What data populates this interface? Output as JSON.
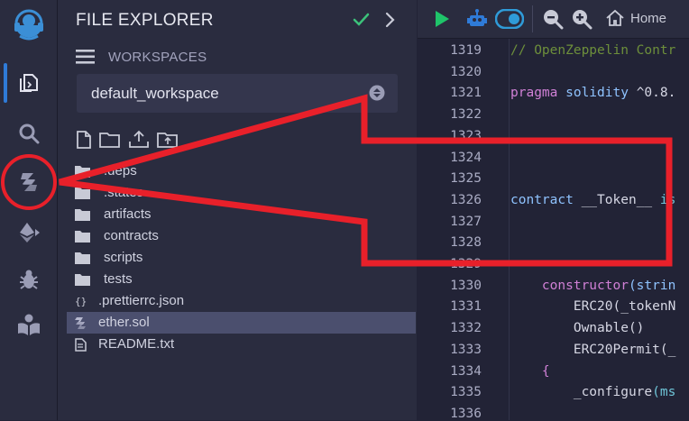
{
  "rail": {
    "items": [
      {
        "name": "logo-icon"
      },
      {
        "name": "file-explorer-icon"
      },
      {
        "name": "search-icon"
      },
      {
        "name": "solidity-compiler-icon"
      },
      {
        "name": "deploy-run-icon"
      },
      {
        "name": "debugger-icon"
      },
      {
        "name": "learneth-icon"
      }
    ]
  },
  "explorer": {
    "title": "FILE EXPLORER",
    "workspaces_label": "WORKSPACES",
    "workspace_value": "default_workspace",
    "actions": [
      "new-file-icon",
      "new-folder-icon",
      "upload-file-icon",
      "upload-folder-icon"
    ],
    "tree": [
      {
        "label": ".deps",
        "type": "folder"
      },
      {
        "label": ".states",
        "type": "folder"
      },
      {
        "label": "artifacts",
        "type": "folder"
      },
      {
        "label": "contracts",
        "type": "folder"
      },
      {
        "label": "scripts",
        "type": "folder"
      },
      {
        "label": "tests",
        "type": "folder"
      },
      {
        "label": ".prettierrc.json",
        "type": "json"
      },
      {
        "label": "ether.sol",
        "type": "sol",
        "selected": true
      },
      {
        "label": "README.txt",
        "type": "txt"
      }
    ]
  },
  "toolbar": {
    "home_label": "Home"
  },
  "editor": {
    "lines": [
      {
        "n": "1319",
        "code": [
          {
            "t": "// OpenZeppelin Contr",
            "c": "c-comment"
          }
        ]
      },
      {
        "n": "1320",
        "code": []
      },
      {
        "n": "1321",
        "code": [
          {
            "t": "pragma ",
            "c": "c-kw"
          },
          {
            "t": "solidity ",
            "c": "c-blue"
          },
          {
            "t": "^0.8.",
            "c": "c-plain"
          }
        ]
      },
      {
        "n": "1322",
        "code": []
      },
      {
        "n": "1323",
        "code": []
      },
      {
        "n": "1324",
        "code": []
      },
      {
        "n": "1325",
        "code": []
      },
      {
        "n": "1326",
        "code": [
          {
            "t": "contract ",
            "c": "c-blue"
          },
          {
            "t": "__Token__ ",
            "c": "c-ident"
          },
          {
            "t": "is",
            "c": "c-cyan"
          }
        ]
      },
      {
        "n": "1327",
        "code": []
      },
      {
        "n": "1328",
        "code": []
      },
      {
        "n": "1329",
        "code": []
      },
      {
        "n": "1330",
        "code": [
          {
            "t": "    constructor",
            "c": "c-kw"
          },
          {
            "t": "(strin",
            "c": "c-blue"
          }
        ]
      },
      {
        "n": "1331",
        "code": [
          {
            "t": "        ERC20",
            "c": "c-plain"
          },
          {
            "t": "(_tokenN",
            "c": "c-plain"
          }
        ]
      },
      {
        "n": "1332",
        "code": [
          {
            "t": "        Ownable()",
            "c": "c-plain"
          }
        ]
      },
      {
        "n": "1333",
        "code": [
          {
            "t": "        ERC20Permit(_",
            "c": "c-plain"
          }
        ]
      },
      {
        "n": "1334",
        "code": [
          {
            "t": "    {",
            "c": "c-kw"
          }
        ]
      },
      {
        "n": "1335",
        "code": [
          {
            "t": "        _configure",
            "c": "c-plain"
          },
          {
            "t": "(ms",
            "c": "c-cyan"
          }
        ]
      },
      {
        "n": "1336",
        "code": []
      }
    ]
  },
  "colors": {
    "accent": "#2f7bd8",
    "annotation": "#e8202a",
    "check": "#3cc27a",
    "run": "#1fc46a"
  }
}
